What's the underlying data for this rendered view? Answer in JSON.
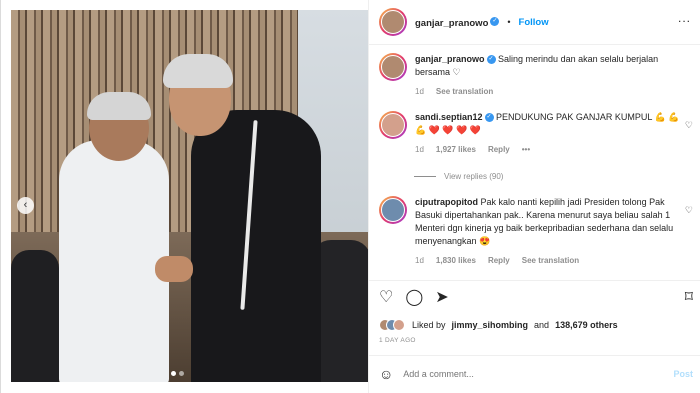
{
  "post": {
    "username": "ganjar_pranowo",
    "follow_label": "Follow",
    "separator": "•",
    "more_label": "...",
    "caption": "Saling merindu dan akan selalu berjalan bersama ♡",
    "caption_age": "1d",
    "see_translation": "See translation",
    "likes_prefix": "Liked by",
    "likes_user": "jimmy_sihombing",
    "likes_suffix": "and",
    "likes_count": "138,679 others",
    "date": "1 DAY AGO",
    "add_comment_placeholder": "Add a comment...",
    "post_label": "Post"
  },
  "comments": [
    {
      "username": "sandi.septian12",
      "text": "PENDUKUNG PAK GANJAR KUMPUL 💪 💪 💪 ❤️ ❤️ ❤️ ❤️",
      "age": "1d",
      "likes": "1,927 likes",
      "reply": "Reply",
      "more": "•••",
      "view_replies": "View replies (90)"
    },
    {
      "username": "ciputrapopitod",
      "text": "Pak kalo nanti kepilih jadi Presiden tolong Pak Basuki dipertahankan pak.. Karena menurut saya beliau salah 1 Menteri dgn kinerja yg baik berkepribadian sederhana dan selalu menyenangkan 😍",
      "age": "1d",
      "likes": "1,830 likes",
      "reply": "Reply",
      "see_translation": "See translation"
    }
  ],
  "icons": {
    "heart": "♡",
    "comment": "◯",
    "share": "➤",
    "bookmark": "⌑",
    "emoji": "☺",
    "arrow_left": "‹"
  },
  "colors": {
    "accent": "#0095f6",
    "verified": "#3897f0",
    "muted": "#8e8e8e"
  }
}
